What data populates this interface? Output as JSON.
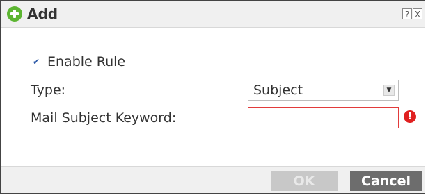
{
  "dialog": {
    "title": "Add",
    "help_label": "?",
    "close_label": "X"
  },
  "form": {
    "enable_rule": {
      "label": "Enable Rule",
      "checked": true
    },
    "type": {
      "label": "Type:",
      "value": "Subject"
    },
    "mail_subject_keyword": {
      "label": "Mail Subject Keyword:",
      "value": "",
      "error_icon": "!"
    }
  },
  "footer": {
    "ok_label": "OK",
    "cancel_label": "Cancel"
  },
  "colors": {
    "add_icon": "#5cb531",
    "error": "#e02020",
    "cancel_button": "#6d6d6d",
    "ok_button_disabled": "#c8c8c8"
  }
}
